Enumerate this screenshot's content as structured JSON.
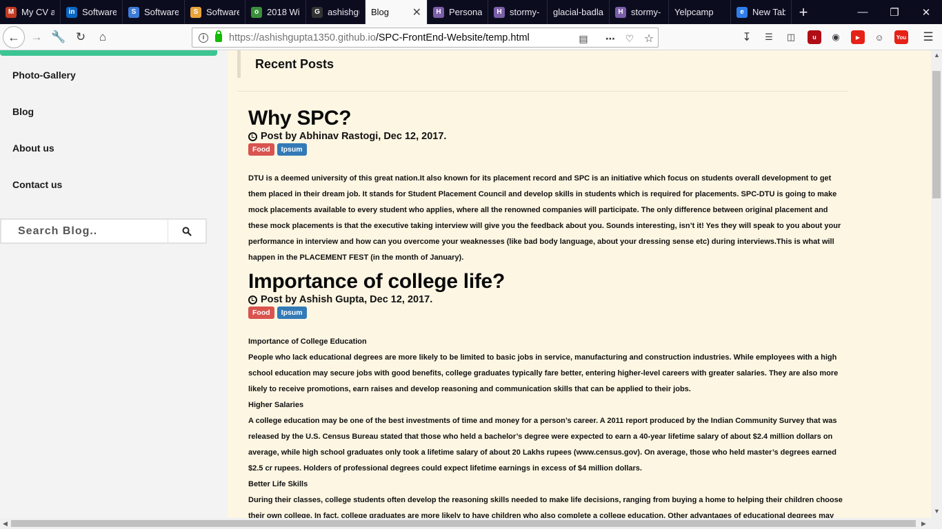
{
  "browser": {
    "tabs": [
      {
        "label": "My CV a",
        "favicon_color": "#c23b22",
        "favicon_text": "M"
      },
      {
        "label": "Software",
        "favicon_color": "#0a66c2",
        "favicon_text": "in"
      },
      {
        "label": "Software",
        "favicon_color": "#3d7bd8",
        "favicon_text": "S"
      },
      {
        "label": "Software",
        "favicon_color": "#e8a33a",
        "favicon_text": "S"
      },
      {
        "label": "2018 Wi",
        "favicon_color": "#3b8f3b",
        "favicon_text": "o"
      },
      {
        "label": "ashishgu",
        "favicon_color": "#333333",
        "favicon_text": "G"
      },
      {
        "label": "Blog",
        "favicon_color": "",
        "favicon_text": "",
        "active": true
      },
      {
        "label": "Personal",
        "favicon_color": "#7b5ea7",
        "favicon_text": "H"
      },
      {
        "label": "stormy-",
        "favicon_color": "#7b5ea7",
        "favicon_text": "H"
      },
      {
        "label": "glacial-badla",
        "favicon_color": "",
        "favicon_text": ""
      },
      {
        "label": "stormy-",
        "favicon_color": "#7b5ea7",
        "favicon_text": "H"
      },
      {
        "label": "Yelpcamp",
        "favicon_color": "",
        "favicon_text": ""
      },
      {
        "label": "New Tab",
        "favicon_color": "#2e7de9",
        "favicon_text": "e"
      }
    ],
    "url_host": "https://ashishgupta1350.github.io",
    "url_path": "/SPC-FrontEnd-Website/temp.html"
  },
  "sidebar": {
    "nav": [
      "Photo-Gallery",
      "Blog",
      "About us",
      "Contact us"
    ],
    "search_placeholder": "Search Blog.."
  },
  "main": {
    "section_title": "Recent Posts",
    "posts": [
      {
        "title": "Why SPC?",
        "meta": "Post by Abhinav Rastogi, Dec 12, 2017.",
        "tags": [
          "Food",
          "Ipsum"
        ],
        "paragraphs": [
          "DTU is a deemed university of this great nation.It also known for its placement record and SPC is an initiative which focus on students overall development to get them placed in their dream job. It stands for Student Placement Council and develop skills in students which is required for placements. SPC-DTU is going to make mock placements available to every student who applies, where all the renowned companies will participate. The only difference between original placement and these mock placements is that the executive taking interview will give you the feedback about you. Sounds interesting, isn’t it! Yes they will speak to you about your performance in interview and how can you overcome your weaknesses (like bad body language, about your dressing sense etc) during interviews.This is what will happen in the PLACEMENT FEST (in the month of January)."
        ]
      },
      {
        "title": "Importance of college life?",
        "meta": "Post by Ashish Gupta, Dec 12, 2017.",
        "tags": [
          "Food",
          "Ipsum"
        ],
        "paragraphs": [
          "Importance of College Education",
          "People who lack educational degrees are more likely to be limited to basic jobs in service, manufacturing and construction industries. While employees with a high school education may secure jobs with good benefits, college graduates typically fare better, entering higher-level careers with greater salaries. They are also more likely to receive promotions, earn raises and develop reasoning and communication skills that can be applied to their jobs.",
          "Higher Salaries",
          "A college education may be one of the best investments of time and money for a person’s career. A 2011 report produced by the Indian Community Survey that was released by the U.S. Census Bureau stated that those who held a bachelor’s degree were expected to earn a 40-year lifetime salary of about $2.4 million dollars on average, while high school graduates only took a lifetime salary of about 20 Lakhs rupees (www.census.gov). On average, those who held master’s degrees earned $2.5 cr rupees. Holders of professional degrees could expect lifetime earnings in excess of $4 million dollars.",
          "Better Life Skills",
          "During their classes, college students often develop the reasoning skills needed to make life decisions, ranging from buying a home to helping their children choose their own college. In fact, college graduates are more likely to have children who also complete a college education. Other advantages of educational degrees may"
        ]
      }
    ]
  },
  "colors": {
    "accent_green": "#3cc593",
    "tag_food": "#d9534f",
    "tag_ipsum": "#337ab7",
    "page_bg": "#fdf6e3",
    "sidebar_bg": "#f3f3f3"
  },
  "icons": [
    "back-arrow-icon",
    "forward-arrow-icon",
    "wrench-icon",
    "reload-icon",
    "home-icon",
    "info-icon",
    "lock-icon",
    "reader-view-icon",
    "more-icon",
    "pocket-icon",
    "star-icon",
    "download-icon",
    "library-icon",
    "sidebar-icon",
    "search-icon",
    "clock-icon"
  ]
}
